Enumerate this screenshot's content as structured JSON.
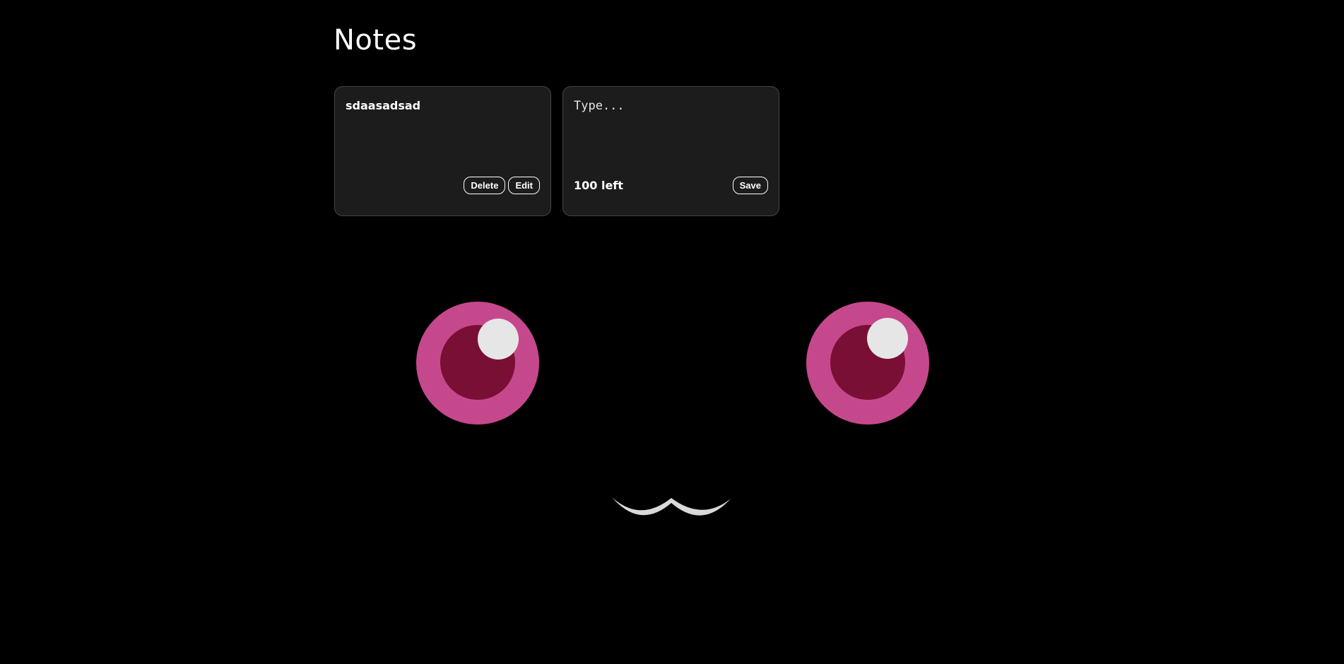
{
  "header": {
    "title": "Notes"
  },
  "notes": [
    {
      "text": "sdaasadsad",
      "delete_label": "Delete",
      "edit_label": "Edit"
    }
  ],
  "new_note": {
    "placeholder": "Type...",
    "chars_left": "100 left",
    "save_label": "Save"
  },
  "colors": {
    "background": "#000000",
    "card": "#1c1c1c",
    "card_border": "#474747",
    "eye_outer": "#c6488c",
    "eye_inner": "#7a0f35",
    "eye_highlight": "#e6e6e6",
    "mouth": "#d9d9d9"
  }
}
